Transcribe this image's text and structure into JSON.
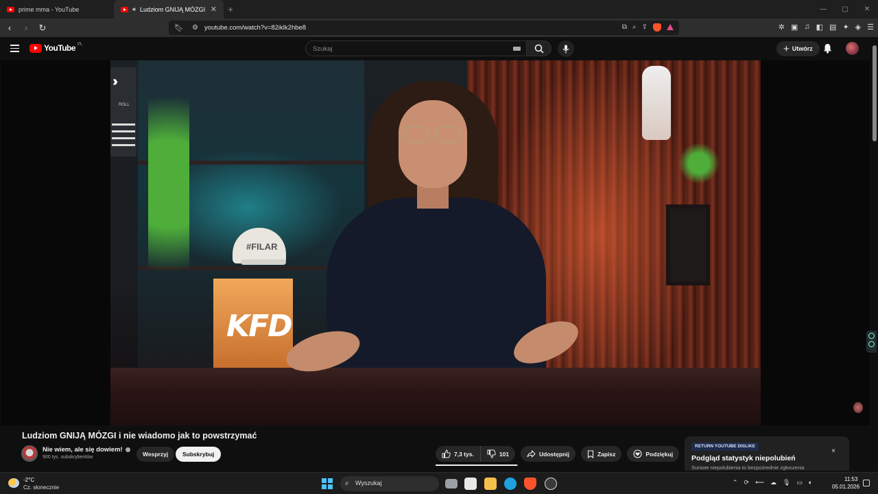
{
  "browser": {
    "tabs": [
      {
        "title": "prime mma - YouTube",
        "active": false
      },
      {
        "title": "Ludziom GNIJĄ MÓZGI i nie wiadomo jak to powstrzymać",
        "active": true
      }
    ],
    "new_tab": "+",
    "url": "youtube.com/watch?v=82iklk2hbe8",
    "window_controls": {
      "minimize": "—",
      "maximize": "▢",
      "close": "✕"
    }
  },
  "masthead": {
    "logo_text": "YouTube",
    "country_code": "PL",
    "search_placeholder": "Szukaj",
    "create_label": "Utwórz",
    "create_icon": "+"
  },
  "video": {
    "sign_text": "KFD",
    "cap_text": "#FILAR",
    "panel_label": "ROLL"
  },
  "watch": {
    "title": "Ludziom GNIJĄ MÓZGI i nie wiadomo jak to powstrzymać",
    "channel_name": "Nie wiem, ale się dowiem!",
    "subscribers": "900 tys. subskrybentów",
    "join_label": "Wesprzyj",
    "subscribe_label": "Subskrybuj",
    "likes": "7,3 tys.",
    "dislikes": "101",
    "like_ratio": 0.986,
    "share_label": "Udostępnij",
    "save_label": "Zapisz",
    "thanks_label": "Podziękuj",
    "more_label": "···"
  },
  "rtd_card": {
    "tag": "RETURN YOUTUBE DISLIKE",
    "title": "Podgląd statystyk niepolubień",
    "description": "Surowe niepolubienia to bezpośrednie zgłoszenia",
    "close": "×"
  },
  "taskbar": {
    "weather_temp": "-2°C",
    "weather_desc": "Cz. słonecznie",
    "search_placeholder": "Wyszukaj",
    "time": "11:53",
    "date": "05.01.2026"
  },
  "colors": {
    "youtube_red": "#ff0000",
    "background": "#0f0f0f",
    "pill": "#272727",
    "windows_accent": "#4cc2ff"
  }
}
